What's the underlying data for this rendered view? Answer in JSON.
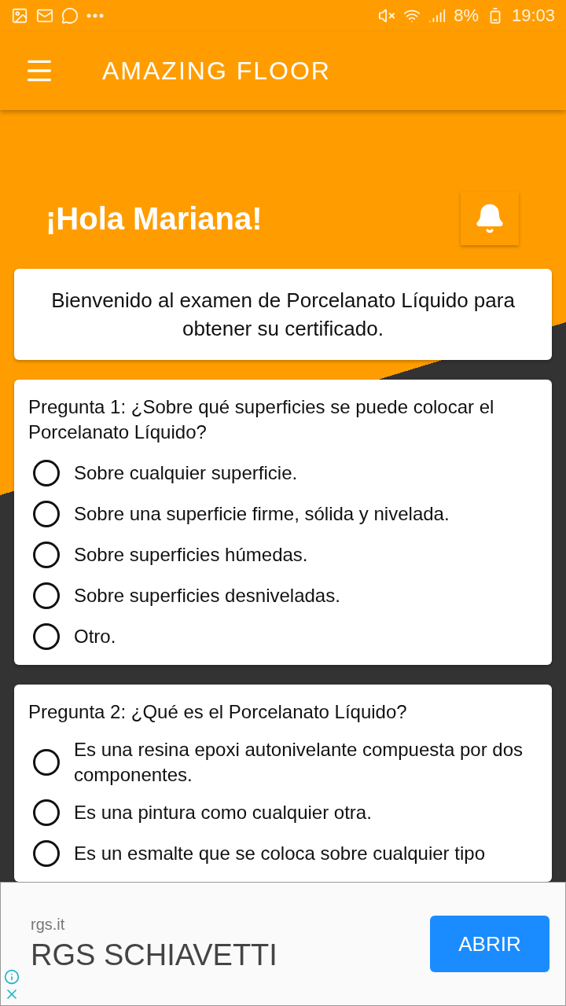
{
  "status_bar": {
    "battery": "8%",
    "time": "19:03"
  },
  "app_bar": {
    "title": "AMAZING FLOOR"
  },
  "greeting": "¡Hola Mariana!",
  "welcome": "Bienvenido al examen de Porcelanato Líquido para obtener su certificado.",
  "questions": [
    {
      "text": "Pregunta 1: ¿Sobre qué superficies se puede colocar el Porcelanato Líquido?",
      "options": [
        {
          "label": "Sobre cualquier superficie.",
          "selected": false
        },
        {
          "label": "Sobre una superficie firme, sólida y nivelada.",
          "selected": false
        },
        {
          "label": "Sobre superficies húmedas.",
          "selected": false
        },
        {
          "label": "Sobre superficies desniveladas.",
          "selected": false
        },
        {
          "label": "Otro.",
          "selected": false
        }
      ]
    },
    {
      "text": "Pregunta 2: ¿Qué es el Porcelanato Líquido?",
      "options": [
        {
          "label": "Es una resina epoxi autonivelante compuesta por dos componentes.",
          "selected": false
        },
        {
          "label": "Es una pintura como cualquier otra.",
          "selected": false
        },
        {
          "label": "Es un esmalte que se coloca sobre cualquier tipo",
          "selected": false
        }
      ]
    }
  ],
  "ad": {
    "domain": "rgs.it",
    "headline": "RGS SCHIAVETTI",
    "button": "ABRIR"
  }
}
